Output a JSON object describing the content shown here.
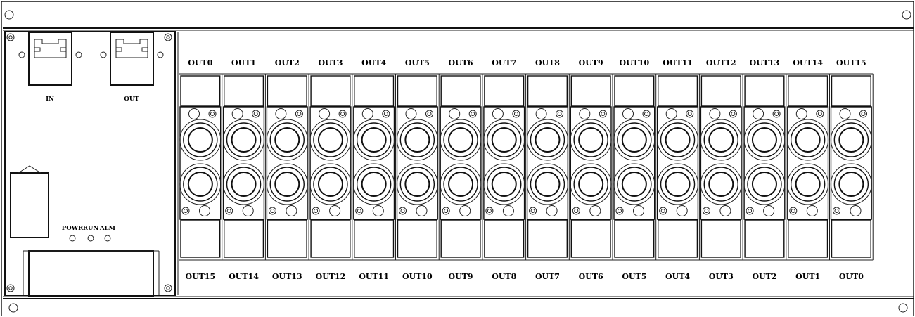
{
  "left_panel": {
    "port_in_label": "IN",
    "port_out_label": "OUT",
    "led_labels": [
      "POWR",
      "RUN",
      "ALM"
    ]
  },
  "top_labels": [
    "OUT0",
    "OUT1",
    "OUT2",
    "OUT3",
    "OUT4",
    "OUT5",
    "OUT6",
    "OUT7",
    "OUT8",
    "OUT9",
    "OUT10",
    "OUT11",
    "OUT12",
    "OUT13",
    "OUT14",
    "OUT15"
  ],
  "bottom_labels": [
    "OUT15",
    "OUT14",
    "OUT13",
    "OUT12",
    "OUT11",
    "OUT10",
    "OUT9",
    "OUT8",
    "OUT7",
    "OUT6",
    "OUT5",
    "OUT4",
    "OUT3",
    "OUT2",
    "OUT1",
    "OUT0"
  ]
}
